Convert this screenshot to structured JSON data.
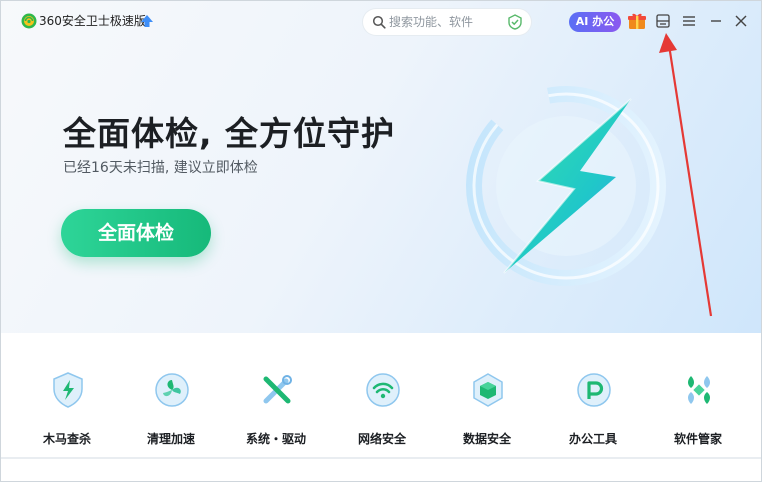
{
  "app": {
    "title": "360安全卫士极速版"
  },
  "search": {
    "placeholder": "搜索功能、软件"
  },
  "header": {
    "ai_label": "AI 办公"
  },
  "hero": {
    "headline": "全面体检, 全方位守护",
    "subline": "已经16天未扫描, 建议立即体检",
    "scan_button": "全面体检"
  },
  "tools": [
    {
      "label": "木马查杀",
      "icon": "trojan-shield-icon"
    },
    {
      "label": "清理加速",
      "icon": "cleanup-fan-icon"
    },
    {
      "label": "系统・驱动",
      "icon": "system-tools-icon"
    },
    {
      "label": "网络安全",
      "icon": "wifi-security-icon"
    },
    {
      "label": "数据安全",
      "icon": "data-cube-icon"
    },
    {
      "label": "办公工具",
      "icon": "office-tools-icon"
    },
    {
      "label": "软件管家",
      "icon": "software-manager-icon"
    }
  ],
  "colors": {
    "accent_green": "#16b97a",
    "ai_gradient_start": "#5a6ff5",
    "ai_gradient_end": "#8b58ef",
    "annotation_red": "#e53935"
  }
}
